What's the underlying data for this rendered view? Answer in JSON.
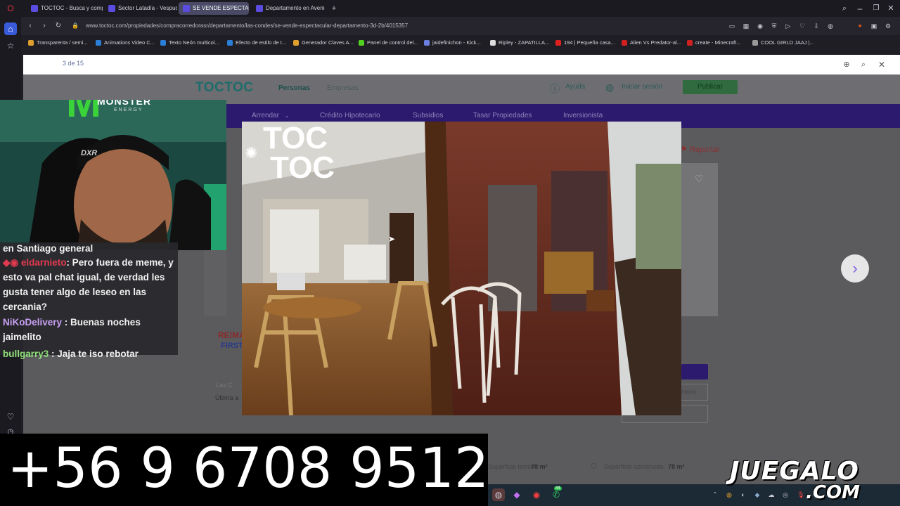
{
  "browser": {
    "tabs": [
      {
        "label": "TOCTOC - Busca y compr"
      },
      {
        "label": "Sector Latadía - Vespucio"
      },
      {
        "label": "SE VENDE ESPECTACULAR"
      },
      {
        "label": "Departamento en Avenida"
      }
    ],
    "url": "www.toctoc.com/propiedades/compracorredorasr/departamento/las-condes/se-vende-espectacular-departamento-3d-2b/4015357",
    "bookmarks": [
      "Transparenta / semi...",
      "Animations Video C...",
      "Texto Neón multicol...",
      "Efecto de estilo de t...",
      "Generador Claves A...",
      "Panel de control del...",
      "jaidefinichon - Kick...",
      "Ripley - ZAPATILLA...",
      "194 | Pequeña casa...",
      "Alien Vs Predator-al...",
      "create - Minecraft...",
      "COOL GIRLD JAAJ |..."
    ]
  },
  "find": {
    "count": "3 de 15"
  },
  "site": {
    "logo": "TOCTOC",
    "tab_personas": "Personas",
    "tab_empresas": "Empresas",
    "help": "Ayuda",
    "login": "Iniciar sesión",
    "publish": "Publicar",
    "nav": [
      "Arrendar",
      "Crédito Hipotecario",
      "Subsidios",
      "Tasar Propiedades",
      "Inversionista"
    ],
    "report": "Reportar",
    "terreno_label": "Superficie terreno:",
    "terreno_value": "78 m²",
    "construida_label": "Superficie construida:",
    "construida_value": "78 m²",
    "partial_location": "Las C",
    "partial_updated": "Última a",
    "partial_remax": "RE/MA",
    "partial_first": "FIRST",
    "partial_contacto": "ntacto"
  },
  "modal": {
    "watermark_line1": "TOC",
    "watermark_line2": "TOC"
  },
  "stream": {
    "brand_text": "MONSTER",
    "brand_sub": "ENERGY",
    "chair_brand": "DXR",
    "chat": [
      {
        "user": "",
        "text": "en Santiago general",
        "color": "#f1f1f1"
      },
      {
        "user": "eldarnieto",
        "text": ": Pero fuera de meme, y esto va pal chat igual, de verdad les gusta tener algo de leseo en las cercania?",
        "color": "#e03a50"
      },
      {
        "user": "NiKoDelivery",
        "text": " : Buenas noches jaimelito",
        "color": "#c9a0f5"
      },
      {
        "user": "bullgarry3",
        "text": " : Jaja te iso rebotar",
        "color": "#8fe07a"
      }
    ],
    "phone": "+56 9 6708 9512",
    "logo_line1": "JUEGALO",
    "logo_line2": ".COM",
    "whatsapp_badge": "44"
  }
}
